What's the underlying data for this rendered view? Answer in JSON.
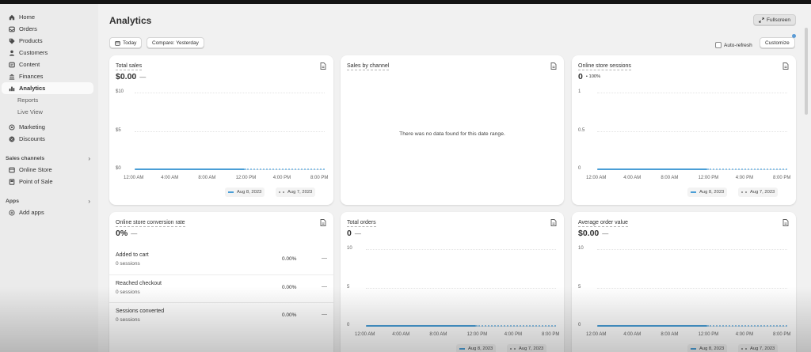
{
  "sidebar": {
    "items": [
      {
        "label": "Home",
        "icon": "home-icon"
      },
      {
        "label": "Orders",
        "icon": "orders-icon"
      },
      {
        "label": "Products",
        "icon": "tag-icon"
      },
      {
        "label": "Customers",
        "icon": "person-icon"
      },
      {
        "label": "Content",
        "icon": "content-icon"
      },
      {
        "label": "Finances",
        "icon": "bank-icon"
      },
      {
        "label": "Analytics",
        "icon": "bar-chart-icon"
      }
    ],
    "analytics_sub": [
      "Reports",
      "Live View"
    ],
    "items2": [
      {
        "label": "Marketing",
        "icon": "target-icon"
      },
      {
        "label": "Discounts",
        "icon": "discount-icon"
      }
    ],
    "sales_channels_label": "Sales channels",
    "channels": [
      {
        "label": "Online Store",
        "icon": "store-icon"
      },
      {
        "label": "Point of Sale",
        "icon": "pos-icon"
      }
    ],
    "apps_label": "Apps",
    "add_apps_label": "Add apps",
    "chevron": "›"
  },
  "header": {
    "title": "Analytics",
    "fullscreen_label": "Fullscreen",
    "today_label": "Today",
    "compare_label": "Compare: Yesterday",
    "auto_refresh_label": "Auto-refresh",
    "customize_label": "Customize"
  },
  "cards": {
    "total_sales": {
      "title": "Total sales",
      "value": "$0.00",
      "dash": "—"
    },
    "sales_by_channel": {
      "title": "Sales by channel",
      "empty_text": "There was no data found for this date range."
    },
    "sessions": {
      "title": "Online store sessions",
      "value": "0",
      "change": "• 100%"
    },
    "conversion": {
      "title": "Online store conversion rate",
      "value": "0%",
      "dash": "—",
      "rows": [
        {
          "label": "Added to cart",
          "sub": "0 sessions",
          "value": "0.00%",
          "dash": "—"
        },
        {
          "label": "Reached checkout",
          "sub": "0 sessions",
          "value": "0.00%",
          "dash": "—"
        },
        {
          "label": "Sessions converted",
          "sub": "0 sessions",
          "value": "0.00%",
          "dash": "—"
        }
      ]
    },
    "total_orders": {
      "title": "Total orders",
      "value": "0",
      "dash": "—"
    },
    "aov": {
      "title": "Average order value",
      "value": "$0.00",
      "dash": "—"
    }
  },
  "chart_data": [
    {
      "type": "line",
      "ylabels": [
        "$10",
        "$5",
        "$0"
      ],
      "x": [
        "12:00 AM",
        "4:00 AM",
        "8:00 AM",
        "12:00 PM",
        "4:00 PM",
        "8:00 PM"
      ],
      "series": [
        {
          "name": "Aug 8, 2023",
          "values": [
            0,
            0,
            0,
            0
          ]
        },
        {
          "name": "Aug 7, 2023",
          "values": [
            0,
            0,
            0,
            0,
            0,
            0
          ]
        }
      ],
      "ylim": [
        0,
        10
      ]
    },
    {
      "type": "line",
      "ylabels": [
        "1",
        "0.5",
        "0"
      ],
      "x": [
        "12:00 AM",
        "4:00 AM",
        "8:00 AM",
        "12:00 PM",
        "4:00 PM",
        "8:00 PM"
      ],
      "series": [
        {
          "name": "Aug 8, 2023",
          "values": [
            0,
            0,
            0,
            0
          ]
        },
        {
          "name": "Aug 7, 2023",
          "values": [
            0,
            0,
            0,
            0,
            0,
            0
          ]
        }
      ],
      "ylim": [
        0,
        1
      ]
    },
    {
      "type": "line",
      "ylabels": [
        "10",
        "5",
        "0"
      ],
      "x": [
        "12:00 AM",
        "4:00 AM",
        "8:00 AM",
        "12:00 PM",
        "4:00 PM",
        "8:00 PM"
      ],
      "series": [
        {
          "name": "Aug 8, 2023",
          "values": [
            0,
            0,
            0,
            0
          ]
        },
        {
          "name": "Aug 7, 2023",
          "values": [
            0,
            0,
            0,
            0,
            0,
            0
          ]
        }
      ],
      "ylim": [
        0,
        10
      ]
    },
    {
      "type": "line",
      "ylabels": [
        "10",
        "5",
        "0"
      ],
      "x": [
        "12:00 AM",
        "4:00 AM",
        "8:00 AM",
        "12:00 PM",
        "4:00 PM",
        "8:00 PM"
      ],
      "series": [
        {
          "name": "Aug 8, 2023",
          "values": [
            0,
            0,
            0,
            0
          ]
        },
        {
          "name": "Aug 7, 2023",
          "values": [
            0,
            0,
            0,
            0,
            0,
            0
          ]
        }
      ],
      "ylim": [
        0,
        10
      ]
    }
  ]
}
